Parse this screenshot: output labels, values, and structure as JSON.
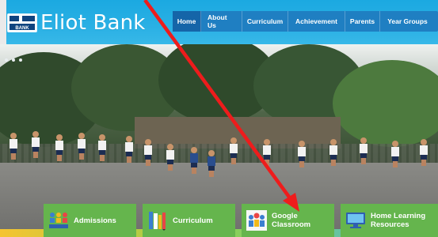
{
  "header": {
    "logo_text": "Eliot Bank",
    "logo_badge_text": "BANK"
  },
  "nav": {
    "items": [
      {
        "label": "Home",
        "active": true
      },
      {
        "label": "About Us"
      },
      {
        "label": "Curriculum"
      },
      {
        "label": "Achievement"
      },
      {
        "label": "Parents"
      },
      {
        "label": "Year Groups"
      }
    ]
  },
  "quick_links": [
    {
      "label": "Admissions",
      "icon": "people-group-icon",
      "line1": "Admissions",
      "line2": ""
    },
    {
      "label": "Curriculum",
      "icon": "books-pencil-icon",
      "line1": "Curriculum",
      "line2": ""
    },
    {
      "label": "Google Classroom",
      "icon": "classroom-people-icon",
      "line1": "Google",
      "line2": "Classroom"
    },
    {
      "label": "Home Learning Resources",
      "icon": "computer-monitor-icon",
      "line1": "Home Learning",
      "line2": "Resources"
    }
  ],
  "colors": {
    "header_blue": "#1ba9e1",
    "nav_bg": "#1f7fc2",
    "nav_active": "#1565a8",
    "tile_green": "#65b54d",
    "annotation_red": "#ee1c1c"
  }
}
